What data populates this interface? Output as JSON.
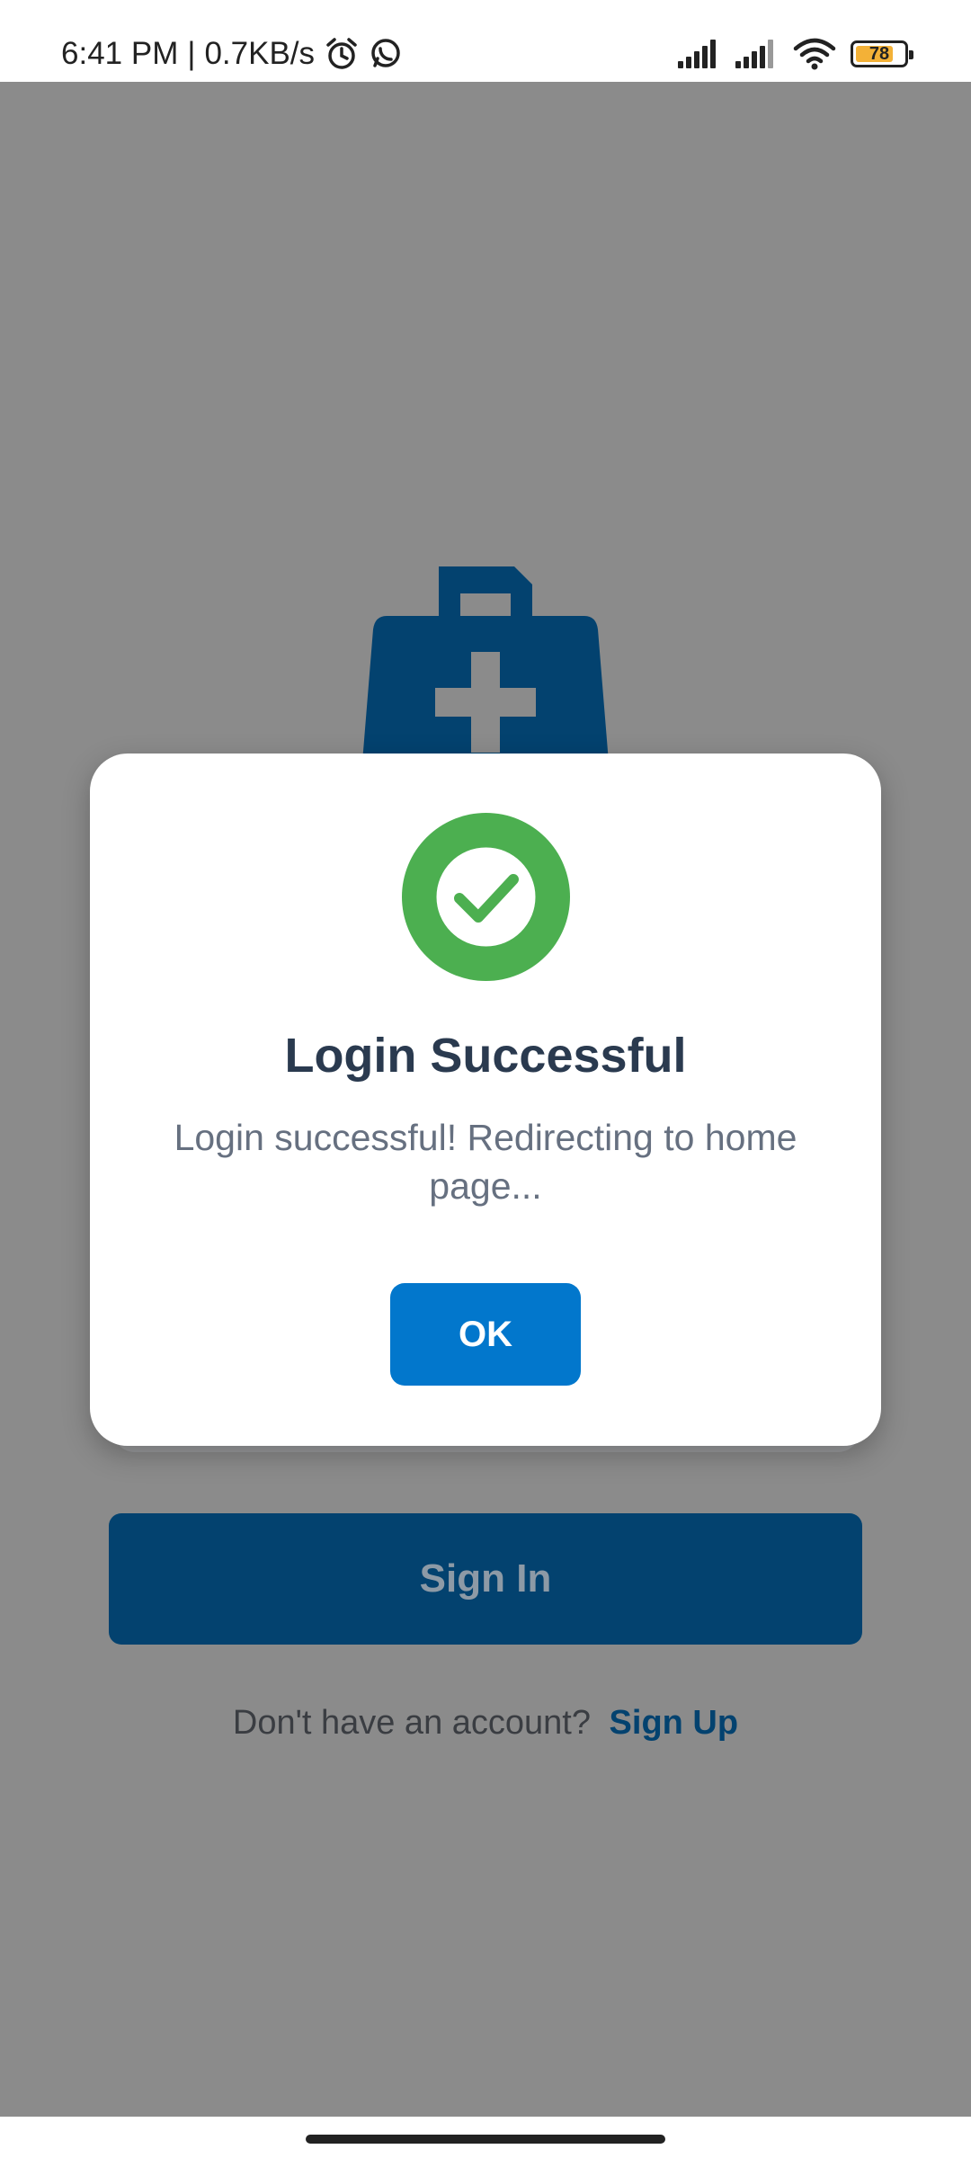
{
  "status_bar": {
    "time": "6:41 PM",
    "separator": "|",
    "speed": "0.7KB/s",
    "icons": [
      "alarm-icon",
      "whatsapp-icon",
      "signal-icon",
      "signal-icon",
      "wifi-icon",
      "battery-icon"
    ],
    "battery_level": "78",
    "battery_color": "#f3b137"
  },
  "app": {
    "logo_icon": "medical-bag-icon",
    "brand_color": "#03426f",
    "signin_label": "Sign In",
    "signup_prompt": "Don't have an account?",
    "signup_link": "Sign Up"
  },
  "dialog": {
    "icon": "check-circle-icon",
    "icon_color": "#4caf50",
    "title": "Login Successful",
    "message": "Login successful! Redirecting to home page...",
    "ok_label": "OK",
    "ok_color": "#0277cc"
  }
}
